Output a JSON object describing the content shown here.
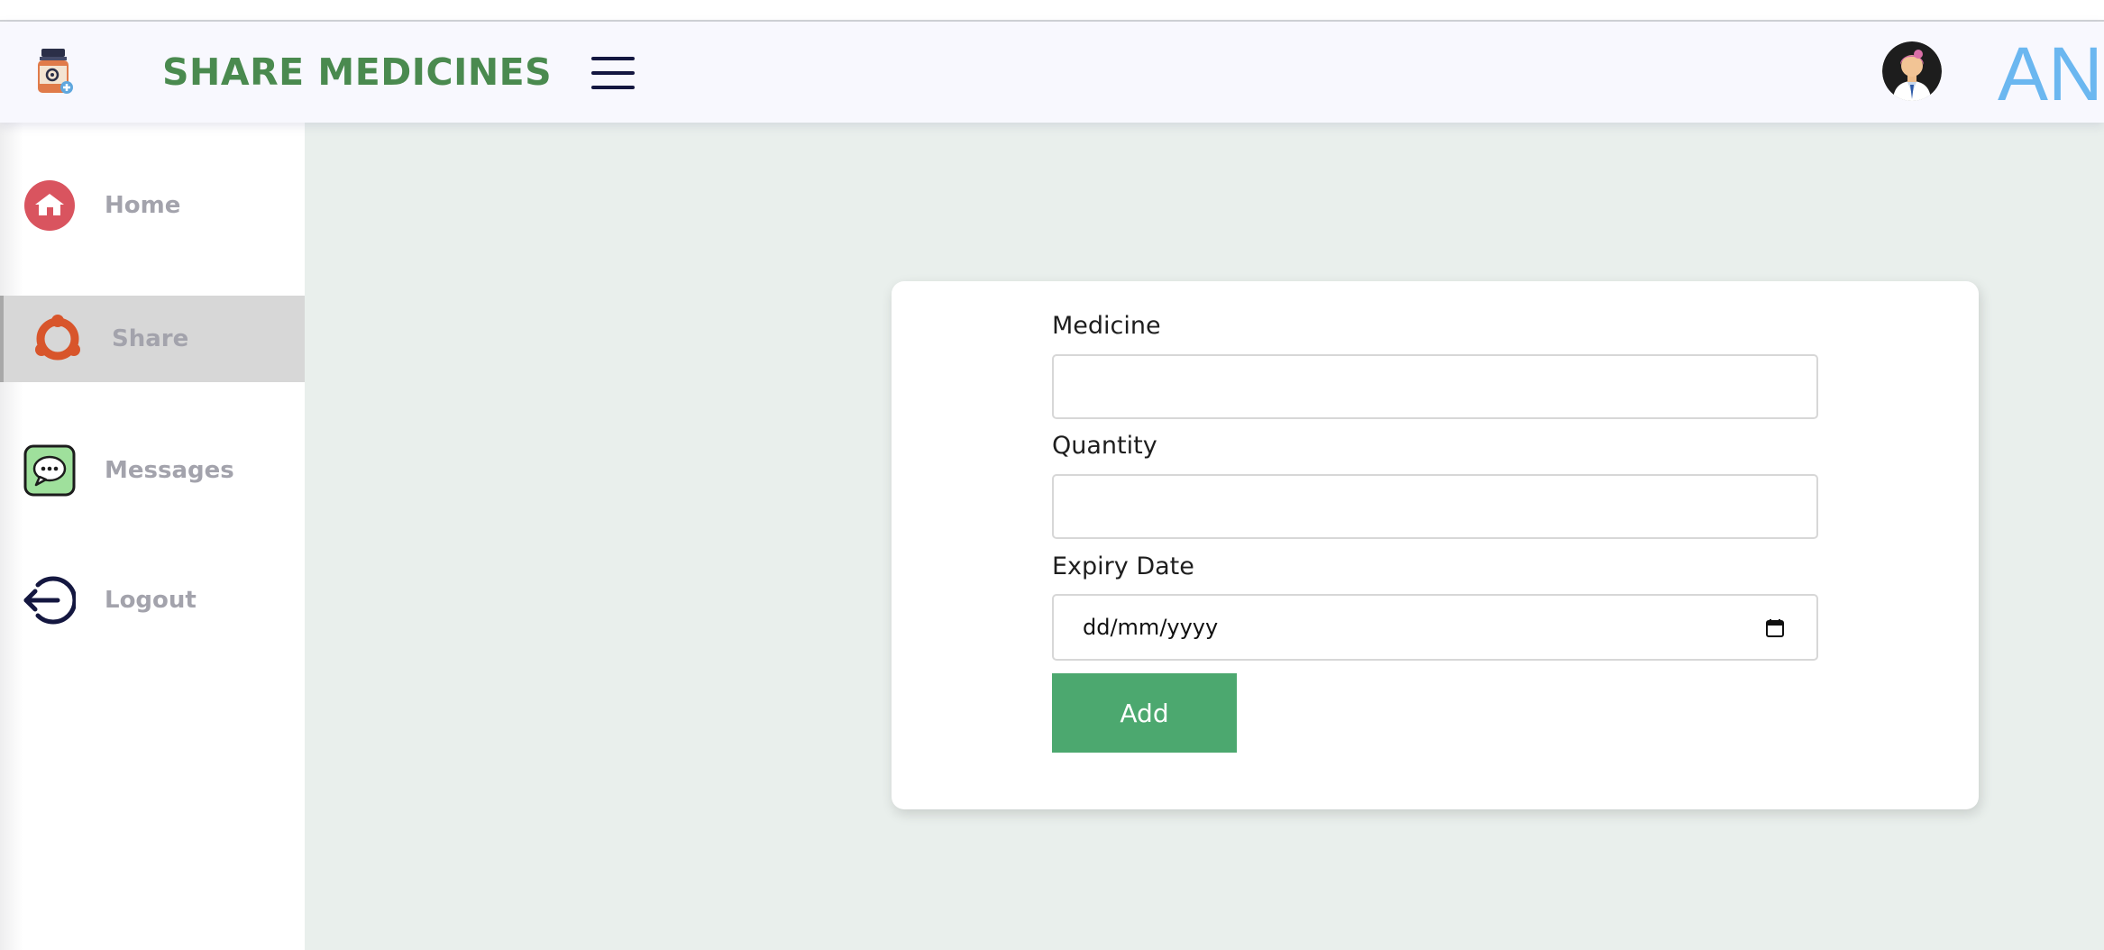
{
  "header": {
    "brand": "SHARE MEDICINES",
    "user_name": "ANU",
    "logo_icon": "medicine-bottle-icon",
    "menu_icon": "hamburger-menu-icon",
    "avatar_icon": "user-avatar-icon"
  },
  "sidebar": {
    "items": [
      {
        "label": "Home",
        "icon": "home-icon",
        "active": false
      },
      {
        "label": "Share",
        "icon": "share-icon",
        "active": true
      },
      {
        "label": "Messages",
        "icon": "chat-bubble-icon",
        "active": false
      },
      {
        "label": "Logout",
        "icon": "logout-icon",
        "active": false
      }
    ]
  },
  "form": {
    "medicine_label": "Medicine",
    "medicine_value": "",
    "quantity_label": "Quantity",
    "quantity_value": "",
    "expiry_label": "Expiry Date",
    "expiry_placeholder": "dd/mm/yyyy",
    "add_label": "Add"
  },
  "colors": {
    "brand_green": "#4a8a4f",
    "button_green": "#4ca86f",
    "user_name_blue": "#6bb7f0",
    "page_background": "#e9efec",
    "active_nav_background": "#d7d7d7"
  }
}
